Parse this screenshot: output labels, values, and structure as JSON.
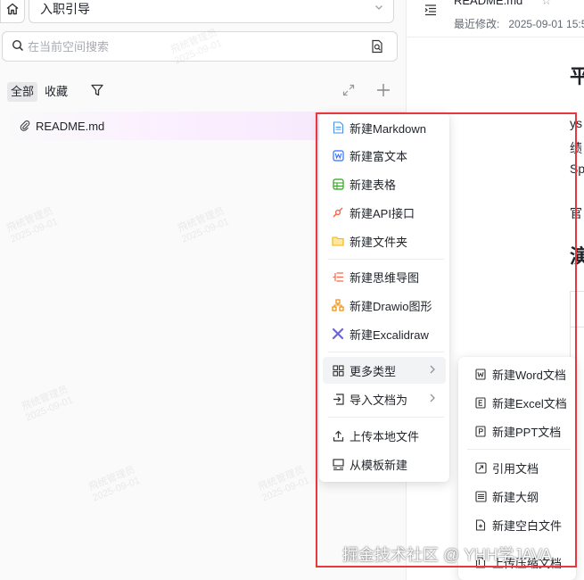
{
  "space": {
    "name": "入职引导"
  },
  "search": {
    "placeholder": "在当前空间搜索"
  },
  "tabs": [
    {
      "label": "全部",
      "active": true
    },
    {
      "label": "收藏",
      "active": false
    }
  ],
  "tree": {
    "file_name": "README.md"
  },
  "doc": {
    "title": "README.md",
    "modified_label": "最近修改:",
    "modified_value": "2025-09-01 15:5",
    "visible_chars": {
      "h1": "平",
      "p1": "ys",
      "p2": "绩",
      "p3": "Sp",
      "p4": "官",
      "h2": "演"
    }
  },
  "menu": {
    "items": [
      {
        "label": "新建Markdown",
        "icon": "markdown-file-icon"
      },
      {
        "label": "新建富文本",
        "icon": "word-doc-icon"
      },
      {
        "label": "新建表格",
        "icon": "spreadsheet-icon"
      },
      {
        "label": "新建API接口",
        "icon": "api-icon"
      },
      {
        "label": "新建文件夹",
        "icon": "folder-icon"
      },
      {
        "label": "新建思维导图",
        "icon": "mindmap-icon"
      },
      {
        "label": "新建Drawio图形",
        "icon": "drawio-icon"
      },
      {
        "label": "新建Excalidraw",
        "icon": "excalidraw-icon"
      },
      {
        "label": "更多类型",
        "icon": "grid-icon"
      },
      {
        "label": "导入文档为",
        "icon": "import-icon"
      },
      {
        "label": "上传本地文件",
        "icon": "upload-icon"
      },
      {
        "label": "从模板新建",
        "icon": "template-icon"
      }
    ]
  },
  "submenu": {
    "items": [
      {
        "label": "新建Word文档",
        "icon": "word-icon"
      },
      {
        "label": "新建Excel文档",
        "icon": "excel-icon"
      },
      {
        "label": "新建PPT文档",
        "icon": "ppt-icon"
      },
      {
        "label": "引用文档",
        "icon": "link-doc-icon"
      },
      {
        "label": "新建大纲",
        "icon": "outline-icon"
      },
      {
        "label": "新建空白文件",
        "icon": "blank-file-icon"
      },
      {
        "label": "上传压缩文档",
        "icon": "archive-icon"
      }
    ]
  },
  "watermark": {
    "line1": "飛统管理员",
    "line2": "2025-09-01"
  },
  "footer_credit": "掘金技术社区 @ YHH学JAVA",
  "colors": {
    "highlight": "#e8383d",
    "accent": "#3370ff",
    "row_highlight": "#f6e6fb"
  }
}
